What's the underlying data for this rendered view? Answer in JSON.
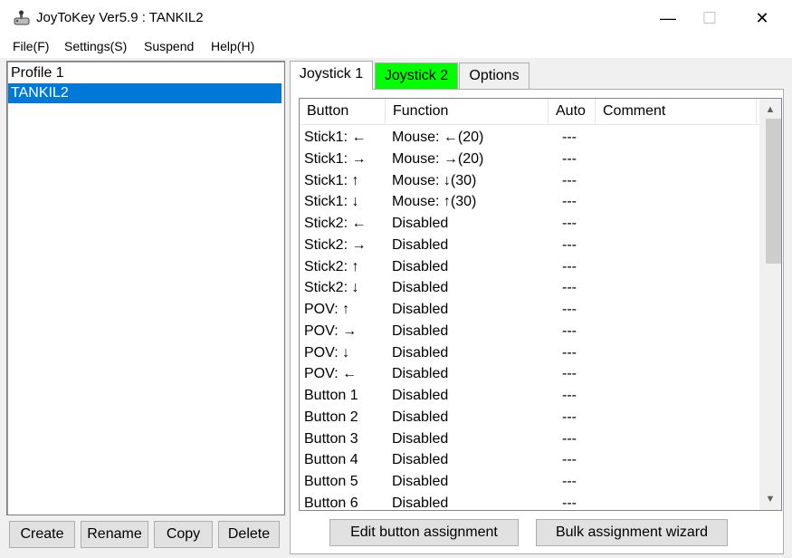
{
  "window": {
    "title": "JoyToKey Ver5.9 : TANKIL2",
    "minimize": "—",
    "maximize": "☐",
    "close": "✕"
  },
  "menu": [
    "File(F)",
    "Settings(S)",
    "Suspend",
    "Help(H)"
  ],
  "profiles": [
    {
      "name": "Profile 1",
      "selected": false
    },
    {
      "name": "TANKIL2",
      "selected": true
    }
  ],
  "profile_buttons": {
    "create": "Create",
    "rename": "Rename",
    "copy": "Copy",
    "delete": "Delete"
  },
  "tabs": [
    {
      "label": "Joystick 1",
      "active": true
    },
    {
      "label": "Joystick 2",
      "active": false,
      "highlight": "#00ff00"
    },
    {
      "label": "Options",
      "active": false
    }
  ],
  "table": {
    "columns": [
      "Button",
      "Function",
      "Auto",
      "Comment"
    ],
    "rows": [
      {
        "button": "Stick1: ←",
        "function": "Mouse: ←(20)",
        "auto": "---",
        "comment": ""
      },
      {
        "button": "Stick1: →",
        "function": "Mouse: →(20)",
        "auto": "---",
        "comment": ""
      },
      {
        "button": "Stick1: ↑",
        "function": "Mouse: ↓(30)",
        "auto": "---",
        "comment": ""
      },
      {
        "button": "Stick1: ↓",
        "function": "Mouse: ↑(30)",
        "auto": "---",
        "comment": ""
      },
      {
        "button": "Stick2: ←",
        "function": "Disabled",
        "auto": "---",
        "comment": ""
      },
      {
        "button": "Stick2: →",
        "function": "Disabled",
        "auto": "---",
        "comment": ""
      },
      {
        "button": "Stick2: ↑",
        "function": "Disabled",
        "auto": "---",
        "comment": ""
      },
      {
        "button": "Stick2: ↓",
        "function": "Disabled",
        "auto": "---",
        "comment": ""
      },
      {
        "button": "POV: ↑",
        "function": "Disabled",
        "auto": "---",
        "comment": ""
      },
      {
        "button": "POV: →",
        "function": "Disabled",
        "auto": "---",
        "comment": ""
      },
      {
        "button": "POV: ↓",
        "function": "Disabled",
        "auto": "---",
        "comment": ""
      },
      {
        "button": "POV: ←",
        "function": "Disabled",
        "auto": "---",
        "comment": ""
      },
      {
        "button": "Button 1",
        "function": "Disabled",
        "auto": "---",
        "comment": ""
      },
      {
        "button": "Button 2",
        "function": "Disabled",
        "auto": "---",
        "comment": ""
      },
      {
        "button": "Button 3",
        "function": "Disabled",
        "auto": "---",
        "comment": ""
      },
      {
        "button": "Button 4",
        "function": "Disabled",
        "auto": "---",
        "comment": ""
      },
      {
        "button": "Button 5",
        "function": "Disabled",
        "auto": "---",
        "comment": ""
      },
      {
        "button": "Button 6",
        "function": "Disabled",
        "auto": "---",
        "comment": ""
      }
    ]
  },
  "actions": {
    "edit": "Edit button assignment",
    "bulk": "Bulk assignment wizard"
  },
  "colors": {
    "selection": "#0078d7",
    "joystick2_tab": "#00ff00"
  }
}
